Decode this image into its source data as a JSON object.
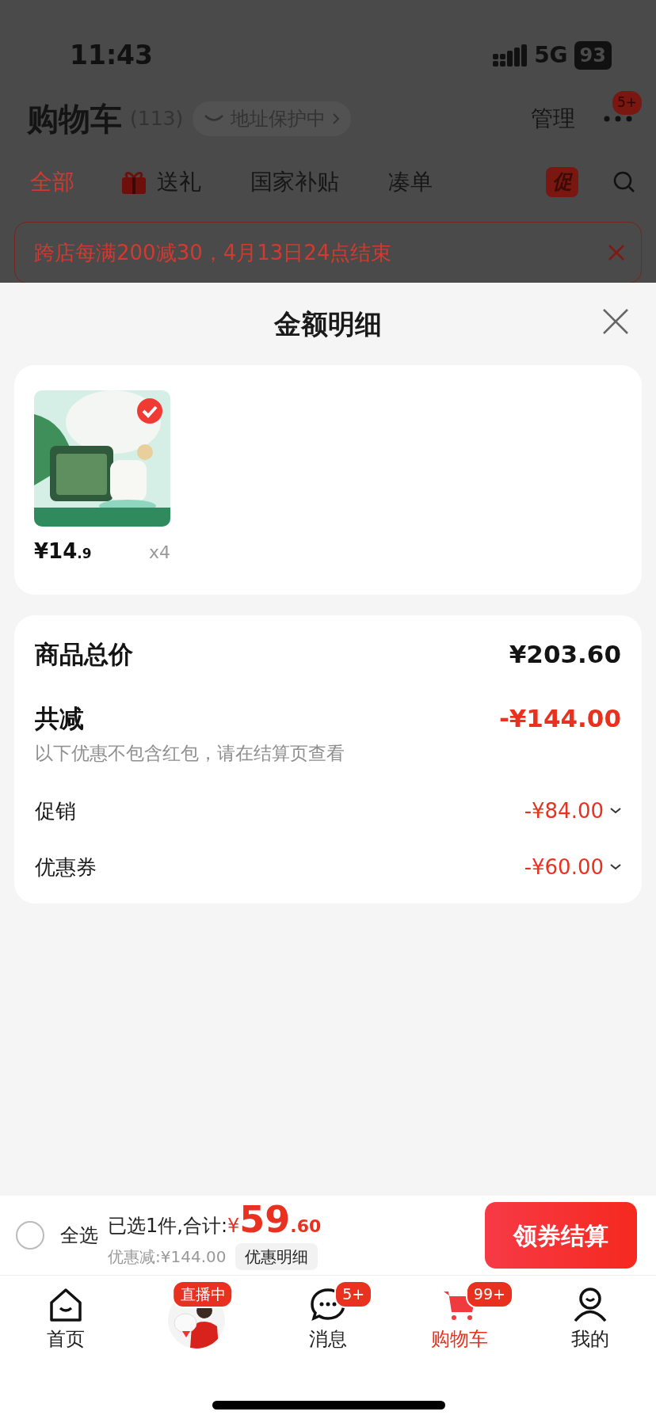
{
  "status_bar": {
    "time": "11:43",
    "network": "5G",
    "battery": "93"
  },
  "header": {
    "title": "购物车",
    "count": "(113)",
    "address_chip": "地址保护中",
    "manage": "管理",
    "more_badge": "5+"
  },
  "tabs": [
    {
      "label": "全部",
      "kind": "text",
      "selected": true
    },
    {
      "label": "送礼",
      "kind": "gift",
      "selected": false
    },
    {
      "label": "国家补贴",
      "kind": "text",
      "selected": false
    },
    {
      "label": "凑单",
      "kind": "text",
      "selected": false
    },
    {
      "label": "促",
      "kind": "badge",
      "selected": false
    }
  ],
  "promo_banner": {
    "text": "跨店每满200减30，4月13日24点结束"
  },
  "sheet": {
    "title": "金额明细",
    "items": [
      {
        "kind": "picture",
        "selected": true,
        "price_main": "¥14",
        "price_decimal": ".9",
        "quantity": "x4"
      }
    ],
    "summary": {
      "total_label": "商品总价",
      "total_value": "¥203.60",
      "discount_label": "共减",
      "discount_value": "-¥144.00",
      "note": "以下优惠不包含红包，请在结算页查看",
      "breakdown": [
        {
          "label": "促销",
          "value": "-¥84.00"
        },
        {
          "label": "优惠券",
          "value": "-¥60.00"
        }
      ]
    }
  },
  "checkout_bar": {
    "select_all": "全选",
    "checked": false,
    "selected_text": "已选1件,合计:",
    "currency": "¥",
    "total_int": "59",
    "total_dec": ".60",
    "discount": "优惠减:¥144.00",
    "details_button": "优惠明细",
    "checkout_button": "领券结算"
  },
  "nav": [
    {
      "kind": "home",
      "label": "首页",
      "selected": false
    },
    {
      "kind": "live",
      "badge": "直播中",
      "selected": false
    },
    {
      "kind": "message",
      "label": "消息",
      "badge": "5+",
      "selected": false
    },
    {
      "kind": "cart",
      "label": "购物车",
      "badge": "99+",
      "selected": true
    },
    {
      "kind": "user",
      "label": "我的",
      "selected": false
    }
  ]
}
